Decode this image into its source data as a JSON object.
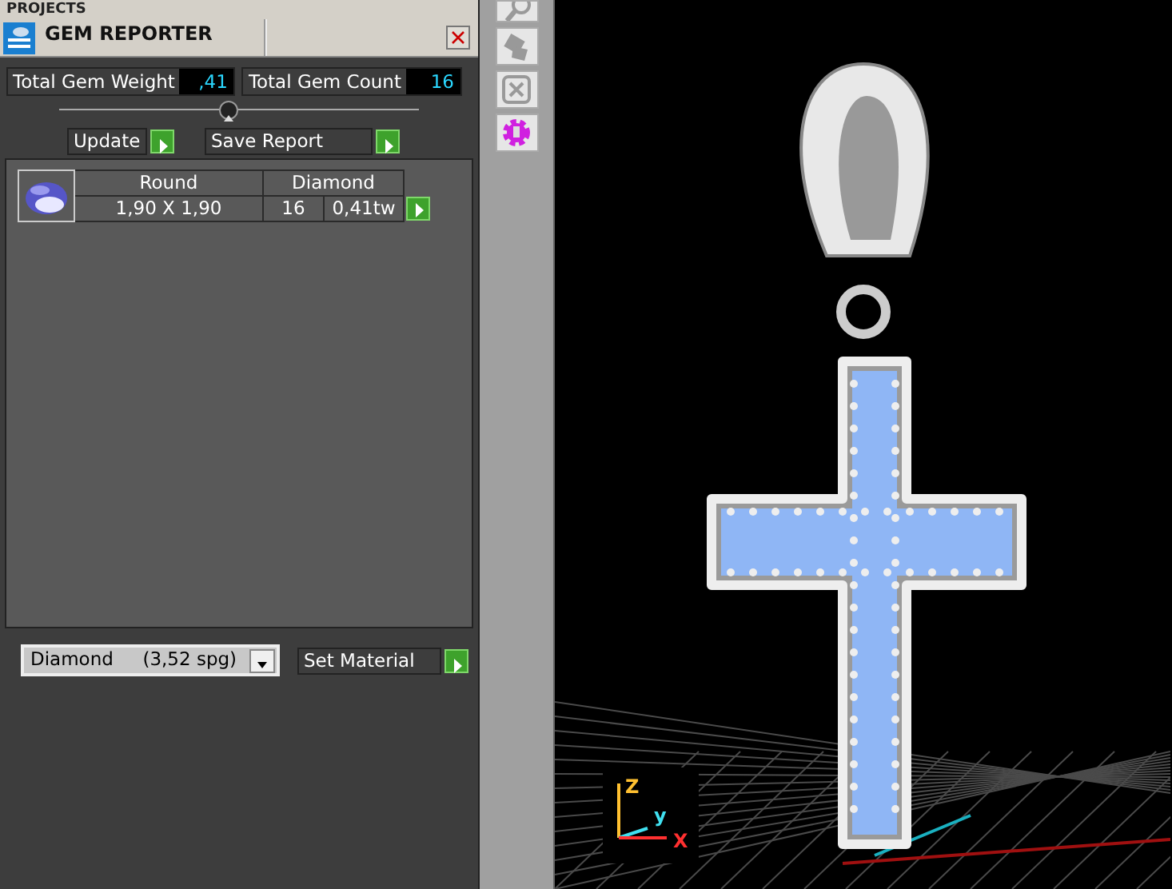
{
  "projects_header": {
    "title": "PROJECTS"
  },
  "gem_reporter": {
    "title": "GEM REPORTER",
    "totals": [
      {
        "label": "Total Gem Weight",
        "value": ",41"
      },
      {
        "label": "Total Gem Count",
        "value": "16"
      }
    ],
    "buttons": [
      "Update",
      "Save Report"
    ],
    "gems": [
      {
        "shape": "Round",
        "material": "Diamond",
        "size": "1,90 X 1,90",
        "count": "16",
        "weight": "0,41tw"
      }
    ],
    "material_select": {
      "value": "Diamond     (3,52 spg)"
    },
    "set_button": "Set Material"
  },
  "toolbar": {
    "tools": [
      {
        "kind": "magnify",
        "disabled": true
      },
      {
        "kind": "transform",
        "disabled": true
      },
      {
        "kind": "frame",
        "disabled": true
      },
      {
        "kind": "gear",
        "disabled": false
      }
    ]
  },
  "viewport": {
    "axes": [
      {
        "kind": "z",
        "label": "Z"
      },
      {
        "kind": "y",
        "label": "y"
      },
      {
        "kind": "x",
        "label": "X"
      }
    ]
  }
}
